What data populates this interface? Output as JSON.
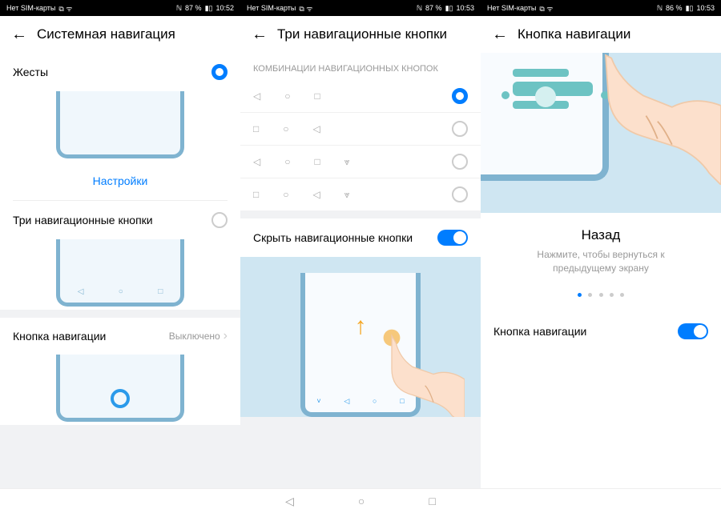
{
  "screens": [
    {
      "statusbar": {
        "left": "Нет SIM-карты",
        "percent": "87 %",
        "time": "10:52"
      },
      "title": "Системная навигация",
      "gestures_label": "Жесты",
      "settings_link": "Настройки",
      "three_buttons_label": "Три навигационные кнопки",
      "nav_dock_label": "Кнопка навигации",
      "nav_dock_status": "Выключено"
    },
    {
      "statusbar": {
        "left": "Нет SIM-карты",
        "percent": "87 %",
        "time": "10:53"
      },
      "title": "Три навигационные кнопки",
      "section": "КОМБИНАЦИИ НАВИГАЦИОННЫХ КНОПОК",
      "hide_nav_label": "Скрыть навигационные кнопки"
    },
    {
      "statusbar": {
        "left": "Нет SIM-карты",
        "percent": "86 %",
        "time": "10:53"
      },
      "title": "Кнопка навигации",
      "tutor_title": "Назад",
      "tutor_desc": "Нажмите, чтобы вернуться к предыдущему экрану",
      "nav_dock_label": "Кнопка навигации"
    }
  ]
}
